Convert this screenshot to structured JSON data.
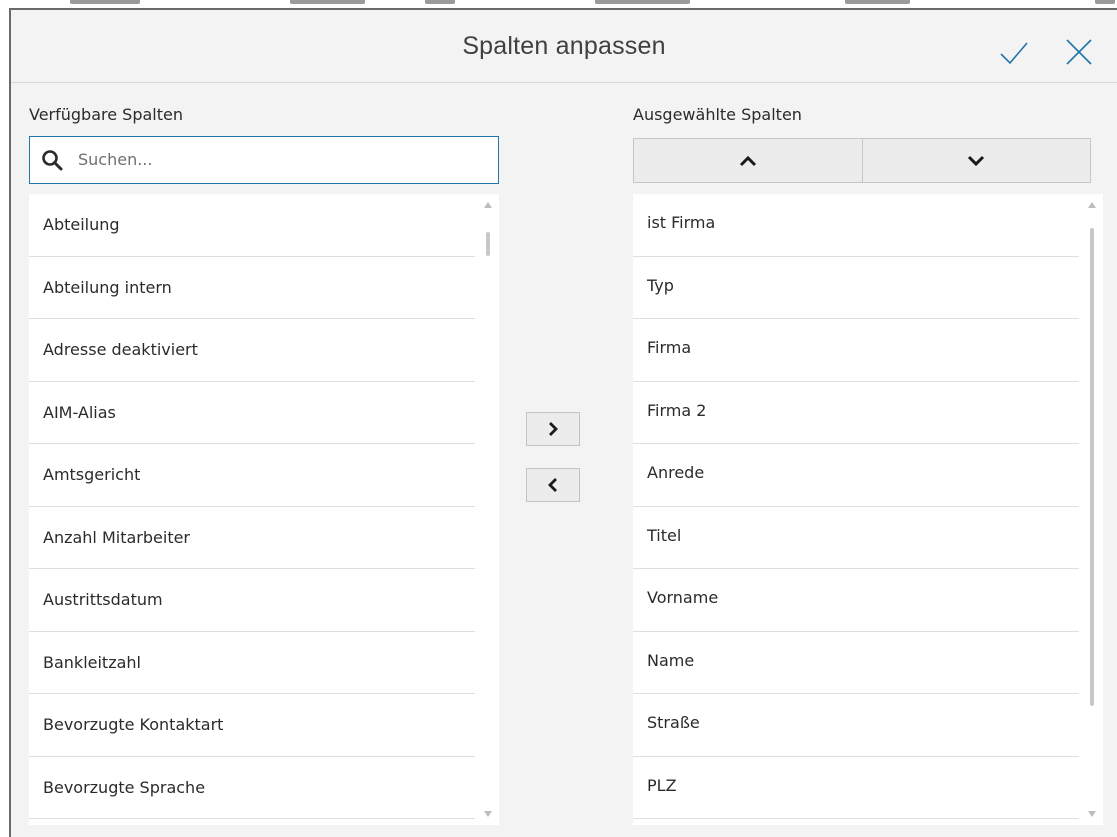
{
  "dialog": {
    "title": "Spalten anpassen",
    "confirm_icon": "check-icon",
    "close_icon": "close-icon"
  },
  "available": {
    "label": "Verfügbare Spalten",
    "search_placeholder": "Suchen...",
    "search_value": "",
    "items": [
      "Abteilung",
      "Abteilung intern",
      "Adresse deaktiviert",
      "AIM-Alias",
      "Amtsgericht",
      "Anzahl Mitarbeiter",
      "Austrittsdatum",
      "Bankleitzahl",
      "Bevorzugte Kontaktart",
      "Bevorzugte Sprache"
    ]
  },
  "selected": {
    "label": "Ausgewählte Spalten",
    "move_up_icon": "chevron-up-icon",
    "move_down_icon": "chevron-down-icon",
    "items": [
      "ist Firma",
      "Typ",
      "Firma",
      "Firma 2",
      "Anrede",
      "Titel",
      "Vorname",
      "Name",
      "Straße",
      "PLZ"
    ]
  },
  "transfer": {
    "add_icon": "chevron-right-icon",
    "remove_icon": "chevron-left-icon"
  },
  "colors": {
    "accent": "#1f75a8",
    "background": "#f3f3f3",
    "list_background": "#ffffff"
  }
}
